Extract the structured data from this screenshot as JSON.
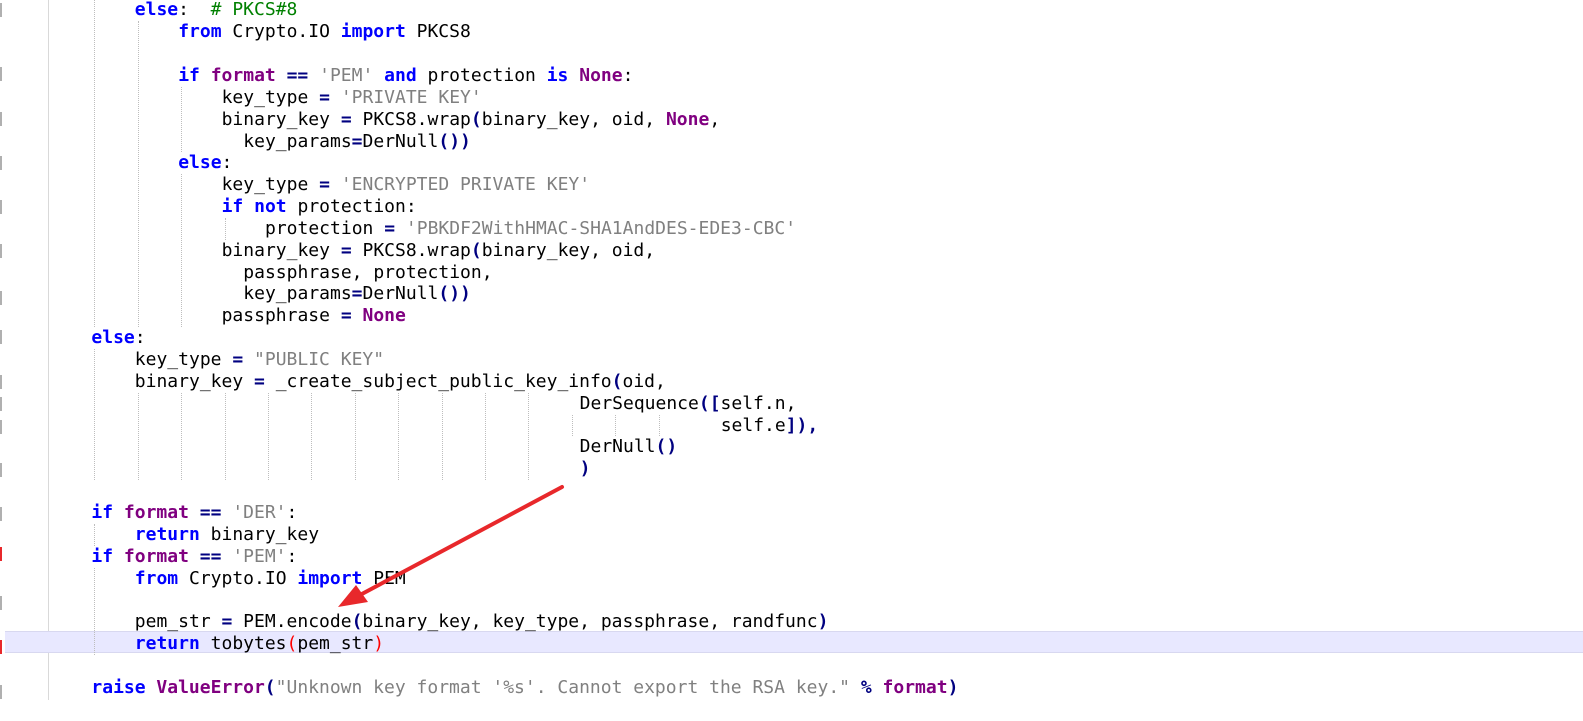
{
  "editor": {
    "language": "python",
    "current_line_index": 29,
    "colors": {
      "keyword": "#0000ff",
      "builtin_keyword": "#800080",
      "string": "#808080",
      "comment": "#008000",
      "operator": "#000080",
      "brace_highlight": "#ff0000",
      "current_line": "#e8e8ff",
      "annotation_arrow": "#e8282b"
    },
    "lines": [
      {
        "indent": 2,
        "tokens": [
          {
            "t": "else",
            "c": "kw"
          },
          {
            "t": ":  ",
            "c": ""
          },
          {
            "t": "# PKCS#8",
            "c": "cm"
          }
        ]
      },
      {
        "indent": 3,
        "tokens": [
          {
            "t": "from",
            "c": "kw"
          },
          {
            "t": " Crypto.IO ",
            "c": ""
          },
          {
            "t": "import",
            "c": "kw"
          },
          {
            "t": " PKCS8",
            "c": ""
          }
        ]
      },
      {
        "indent": 0,
        "tokens": []
      },
      {
        "indent": 3,
        "tokens": [
          {
            "t": "if",
            "c": "kw"
          },
          {
            "t": " ",
            "c": ""
          },
          {
            "t": "format",
            "c": "kw2"
          },
          {
            "t": " ",
            "c": ""
          },
          {
            "t": "==",
            "c": "op"
          },
          {
            "t": " ",
            "c": ""
          },
          {
            "t": "'PEM'",
            "c": "str"
          },
          {
            "t": " ",
            "c": ""
          },
          {
            "t": "and",
            "c": "kw"
          },
          {
            "t": " protection ",
            "c": ""
          },
          {
            "t": "is",
            "c": "kw"
          },
          {
            "t": " ",
            "c": ""
          },
          {
            "t": "None",
            "c": "kw2"
          },
          {
            "t": ":",
            "c": ""
          }
        ]
      },
      {
        "indent": 4,
        "tokens": [
          {
            "t": "key_type ",
            "c": ""
          },
          {
            "t": "=",
            "c": "op"
          },
          {
            "t": " ",
            "c": ""
          },
          {
            "t": "'PRIVATE KEY'",
            "c": "str"
          }
        ]
      },
      {
        "indent": 4,
        "tokens": [
          {
            "t": "binary_key ",
            "c": ""
          },
          {
            "t": "=",
            "c": "op"
          },
          {
            "t": " PKCS8.wrap",
            "c": ""
          },
          {
            "t": "(",
            "c": "op"
          },
          {
            "t": "binary_key, oid, ",
            "c": ""
          },
          {
            "t": "None",
            "c": "kw2"
          },
          {
            "t": ",",
            "c": ""
          }
        ]
      },
      {
        "indent": 0,
        "col": 18,
        "tokens": [
          {
            "t": "key_params",
            "c": ""
          },
          {
            "t": "=",
            "c": "op"
          },
          {
            "t": "DerNull",
            "c": ""
          },
          {
            "t": "())",
            "c": "op"
          }
        ]
      },
      {
        "indent": 3,
        "tokens": [
          {
            "t": "else",
            "c": "kw"
          },
          {
            "t": ":",
            "c": ""
          }
        ]
      },
      {
        "indent": 4,
        "tokens": [
          {
            "t": "key_type ",
            "c": ""
          },
          {
            "t": "=",
            "c": "op"
          },
          {
            "t": " ",
            "c": ""
          },
          {
            "t": "'ENCRYPTED PRIVATE KEY'",
            "c": "str"
          }
        ]
      },
      {
        "indent": 4,
        "tokens": [
          {
            "t": "if",
            "c": "kw"
          },
          {
            "t": " ",
            "c": ""
          },
          {
            "t": "not",
            "c": "kw"
          },
          {
            "t": " protection:",
            "c": ""
          }
        ]
      },
      {
        "indent": 5,
        "tokens": [
          {
            "t": "protection ",
            "c": ""
          },
          {
            "t": "=",
            "c": "op"
          },
          {
            "t": " ",
            "c": ""
          },
          {
            "t": "'PBKDF2WithHMAC-SHA1AndDES-EDE3-CBC'",
            "c": "str"
          }
        ]
      },
      {
        "indent": 4,
        "tokens": [
          {
            "t": "binary_key ",
            "c": ""
          },
          {
            "t": "=",
            "c": "op"
          },
          {
            "t": " PKCS8.wrap",
            "c": ""
          },
          {
            "t": "(",
            "c": "op"
          },
          {
            "t": "binary_key, oid,",
            "c": ""
          }
        ]
      },
      {
        "indent": 0,
        "col": 18,
        "tokens": [
          {
            "t": "passphrase, protection,",
            "c": ""
          }
        ]
      },
      {
        "indent": 0,
        "col": 18,
        "tokens": [
          {
            "t": "key_params",
            "c": ""
          },
          {
            "t": "=",
            "c": "op"
          },
          {
            "t": "DerNull",
            "c": ""
          },
          {
            "t": "())",
            "c": "op"
          }
        ]
      },
      {
        "indent": 4,
        "tokens": [
          {
            "t": "passphrase ",
            "c": ""
          },
          {
            "t": "=",
            "c": "op"
          },
          {
            "t": " ",
            "c": ""
          },
          {
            "t": "None",
            "c": "kw2"
          }
        ]
      },
      {
        "indent": 1,
        "tokens": [
          {
            "t": "else",
            "c": "kw"
          },
          {
            "t": ":",
            "c": ""
          }
        ]
      },
      {
        "indent": 2,
        "tokens": [
          {
            "t": "key_type ",
            "c": ""
          },
          {
            "t": "=",
            "c": "op"
          },
          {
            "t": " ",
            "c": ""
          },
          {
            "t": "\"PUBLIC KEY\"",
            "c": "str"
          }
        ]
      },
      {
        "indent": 2,
        "tokens": [
          {
            "t": "binary_key ",
            "c": ""
          },
          {
            "t": "=",
            "c": "op"
          },
          {
            "t": " _create_subject_public_key_info",
            "c": ""
          },
          {
            "t": "(",
            "c": "op"
          },
          {
            "t": "oid,",
            "c": ""
          }
        ]
      },
      {
        "indent": 0,
        "col": 49,
        "tokens": [
          {
            "t": "DerSequence",
            "c": ""
          },
          {
            "t": "([",
            "c": "op"
          },
          {
            "t": "self.n,",
            "c": ""
          }
        ]
      },
      {
        "indent": 0,
        "col": 62,
        "tokens": [
          {
            "t": "self.e",
            "c": ""
          },
          {
            "t": "]),",
            "c": "op"
          }
        ]
      },
      {
        "indent": 0,
        "col": 49,
        "tokens": [
          {
            "t": "DerNull",
            "c": ""
          },
          {
            "t": "()",
            "c": "op"
          }
        ]
      },
      {
        "indent": 0,
        "col": 49,
        "tokens": [
          {
            "t": ")",
            "c": "op"
          }
        ]
      },
      {
        "indent": 0,
        "tokens": []
      },
      {
        "indent": 1,
        "tokens": [
          {
            "t": "if",
            "c": "kw"
          },
          {
            "t": " ",
            "c": ""
          },
          {
            "t": "format",
            "c": "kw2"
          },
          {
            "t": " ",
            "c": ""
          },
          {
            "t": "==",
            "c": "op"
          },
          {
            "t": " ",
            "c": ""
          },
          {
            "t": "'DER'",
            "c": "str"
          },
          {
            "t": ":",
            "c": ""
          }
        ]
      },
      {
        "indent": 2,
        "tokens": [
          {
            "t": "return",
            "c": "kw"
          },
          {
            "t": " binary_key",
            "c": ""
          }
        ]
      },
      {
        "indent": 1,
        "tokens": [
          {
            "t": "if",
            "c": "kw"
          },
          {
            "t": " ",
            "c": ""
          },
          {
            "t": "format",
            "c": "kw2"
          },
          {
            "t": " ",
            "c": ""
          },
          {
            "t": "==",
            "c": "op"
          },
          {
            "t": " ",
            "c": ""
          },
          {
            "t": "'PEM'",
            "c": "str"
          },
          {
            "t": ":",
            "c": ""
          }
        ]
      },
      {
        "indent": 2,
        "tokens": [
          {
            "t": "from",
            "c": "kw"
          },
          {
            "t": " Crypto.IO ",
            "c": ""
          },
          {
            "t": "import",
            "c": "kw"
          },
          {
            "t": " PEM",
            "c": ""
          }
        ]
      },
      {
        "indent": 0,
        "tokens": []
      },
      {
        "indent": 2,
        "tokens": [
          {
            "t": "pem_str ",
            "c": ""
          },
          {
            "t": "=",
            "c": "op"
          },
          {
            "t": " PEM.encode",
            "c": ""
          },
          {
            "t": "(",
            "c": "op"
          },
          {
            "t": "binary_key, key_type, passphrase, randfunc",
            "c": ""
          },
          {
            "t": ")",
            "c": "op"
          }
        ]
      },
      {
        "indent": 2,
        "tokens": [
          {
            "t": "return",
            "c": "kw"
          },
          {
            "t": " tobytes",
            "c": ""
          },
          {
            "t": "(",
            "c": "hl"
          },
          {
            "t": "pem_str",
            "c": ""
          },
          {
            "t": ")",
            "c": "hl"
          }
        ]
      },
      {
        "indent": 0,
        "tokens": []
      },
      {
        "indent": 1,
        "tokens": [
          {
            "t": "raise",
            "c": "kw"
          },
          {
            "t": " ",
            "c": ""
          },
          {
            "t": "ValueError",
            "c": "kw2"
          },
          {
            "t": "(",
            "c": "op"
          },
          {
            "t": "\"Unknown key format '%s'. Cannot export the RSA key.\"",
            "c": "str"
          },
          {
            "t": " ",
            "c": ""
          },
          {
            "t": "%",
            "c": "op"
          },
          {
            "t": " ",
            "c": ""
          },
          {
            "t": "format",
            "c": "kw2"
          },
          {
            "t": ")",
            "c": "op"
          }
        ]
      }
    ]
  }
}
